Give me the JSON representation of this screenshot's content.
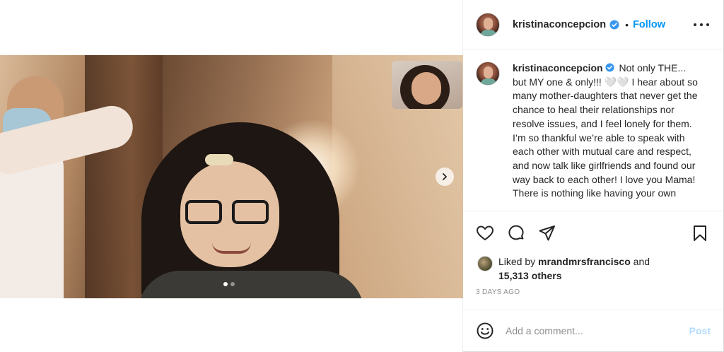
{
  "post": {
    "username": "kristinaconcepcion",
    "follow_label": "Follow",
    "bullet": "•",
    "caption": {
      "username": "kristinaconcepcion",
      "text": "Not only THE... but MY one & only!!! 🤍🤍 I hear about so many mother-daughters that never get the chance to heal their relationships nor resolve issues, and I feel lonely for them. I’m so thankful we’re able to speak with each other with mutual care and respect, and now talk like girlfriends and found our way back to each other! I love you Mama! There is nothing like having your own"
    },
    "likes": {
      "prefix": "Liked by",
      "user": "mrandmrsfrancisco",
      "conjunction": "and",
      "others": "15,313 others"
    },
    "timestamp": "3 DAYS AGO",
    "comment": {
      "placeholder": "Add a comment...",
      "post_label": "Post"
    },
    "carousel": {
      "current_index": 1,
      "total": 2
    }
  },
  "icons": {
    "verified": "verified-badge-icon",
    "more": "more-options-icon",
    "like": "heart-icon",
    "comment": "comment-bubble-icon",
    "share": "paper-plane-icon",
    "save": "bookmark-icon",
    "emoji": "smiley-icon",
    "next": "chevron-right-icon"
  },
  "colors": {
    "accent": "#0095f6",
    "post_disabled": "#b3dbff",
    "verified": "#3897f0",
    "text": "#262626",
    "muted": "#8e8e8e",
    "border": "#efefef"
  }
}
